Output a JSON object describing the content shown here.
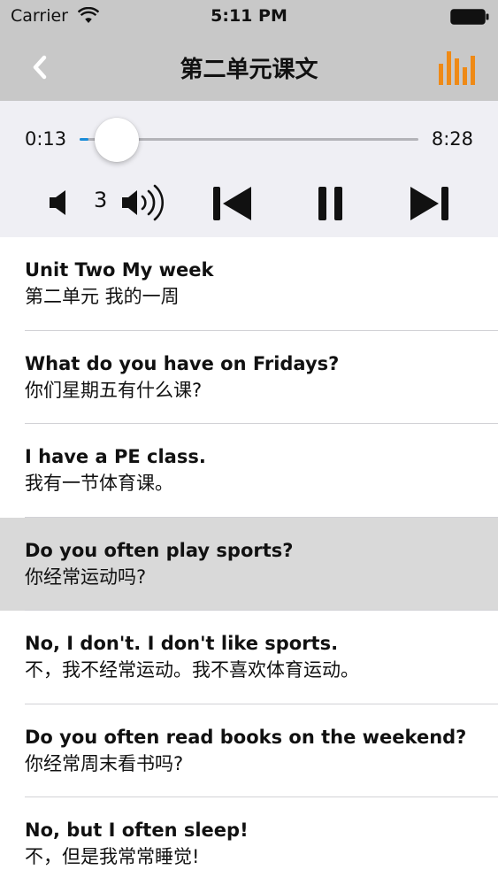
{
  "status_bar": {
    "carrier": "Carrier",
    "time": "5:11 PM"
  },
  "nav_bar": {
    "title": "第二单元课文",
    "back_icon": "chevron-left-icon",
    "right_icon": "equalizer-icon",
    "accent_color": "#ef8a16",
    "background": "#c8c8c8"
  },
  "player": {
    "elapsed": "0:13",
    "total": "8:28",
    "progress": 0.026,
    "volume_level": "3",
    "track_color": "#1a8cd8"
  },
  "lessons": [
    {
      "en": "Unit Two My week",
      "zh": "第二单元 我的一周",
      "selected": false
    },
    {
      "en": "What do you have on Fridays?",
      "zh": "你们星期五有什么课?",
      "selected": false
    },
    {
      "en": "I have a PE class.",
      "zh": "我有一节体育课。",
      "selected": false
    },
    {
      "en": "Do you often play sports?",
      "zh": "你经常运动吗?",
      "selected": true
    },
    {
      "en": "No, I don't. I don't like sports.",
      "zh": "不，我不经常运动。我不喜欢体育运动。",
      "selected": false
    },
    {
      "en": "Do you often read books on the weekend?",
      "zh": "你经常周末看书吗?",
      "selected": false
    },
    {
      "en": "No, but I often sleep!",
      "zh": "不，但是我常常睡觉!",
      "selected": false
    }
  ]
}
